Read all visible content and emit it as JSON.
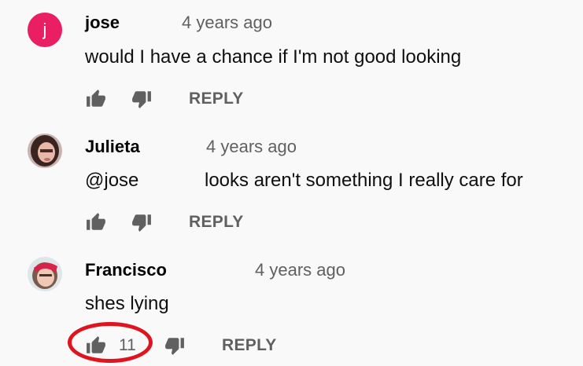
{
  "comments": [
    {
      "author": "jose",
      "avatar_letter": "j",
      "time": "4 years ago",
      "text": "would I have a chance if I'm not good looking",
      "reply_label": "REPLY"
    },
    {
      "author": "Julieta",
      "time": "4 years ago",
      "mention": "@jose",
      "text": "looks aren't something I really care for",
      "reply_label": "REPLY"
    },
    {
      "author": "Francisco",
      "time": "4 years ago",
      "text": "shes lying",
      "like_count": "11",
      "reply_label": "REPLY"
    }
  ],
  "colors": {
    "avatar_letter_bg": "#e91e63",
    "annotation_circle": "#e0141e",
    "secondary_text": "#606060"
  }
}
